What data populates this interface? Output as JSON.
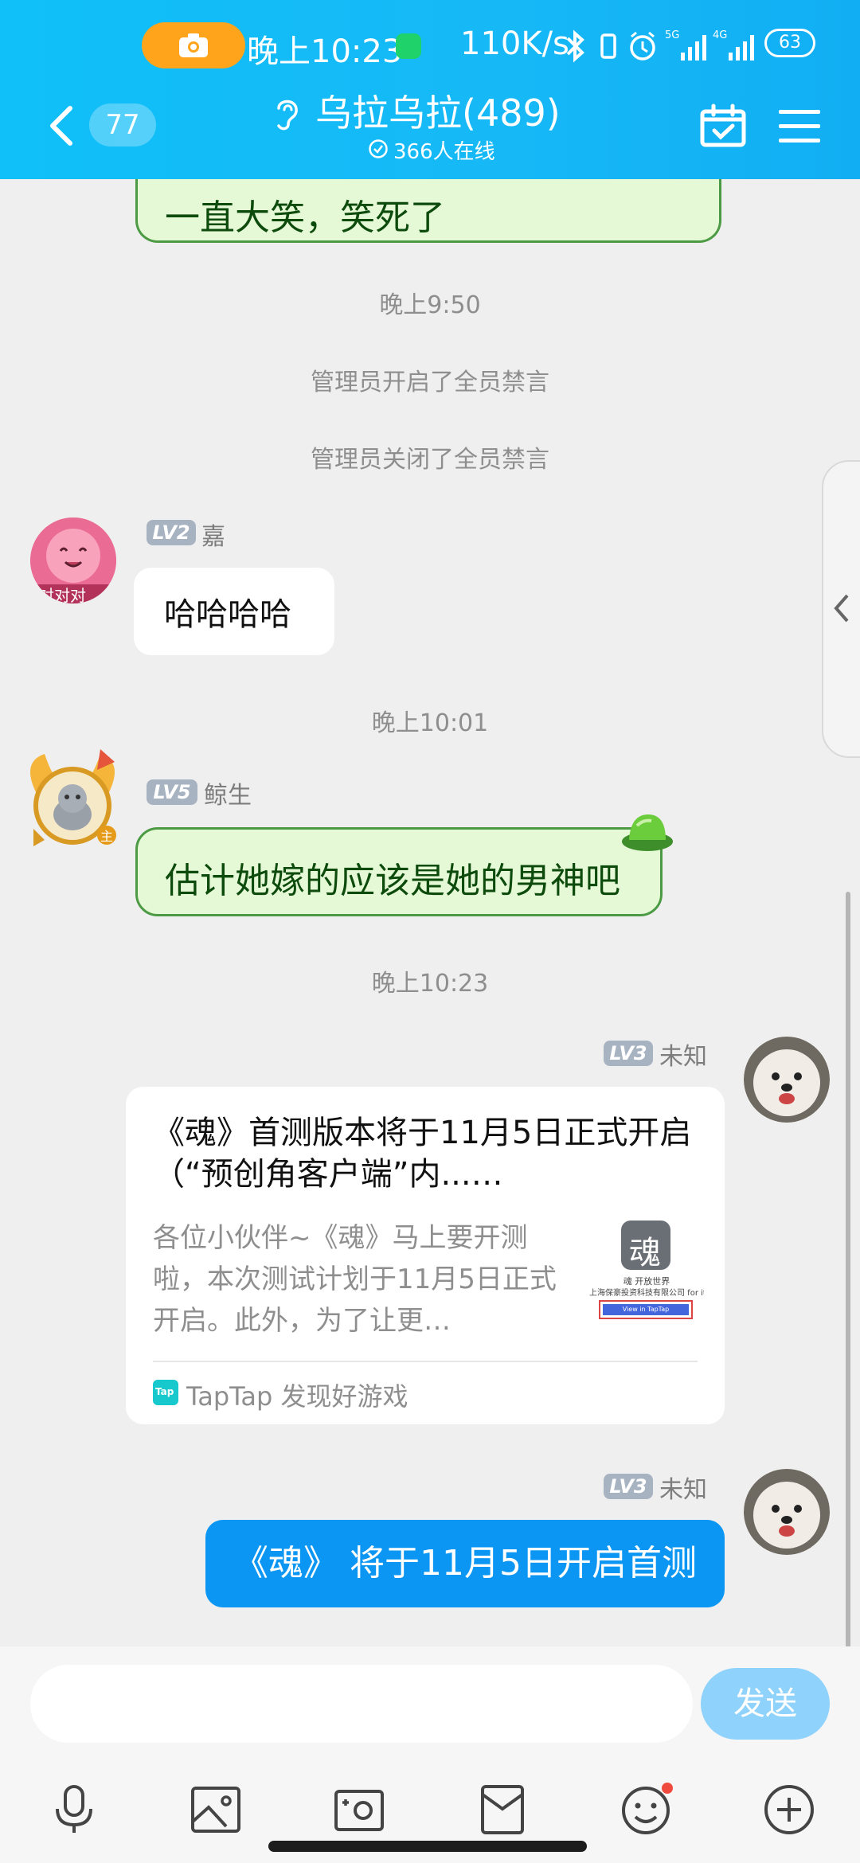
{
  "status_bar": {
    "time": "晚上10:23",
    "net_speed": "110K/s",
    "battery": "63"
  },
  "header": {
    "back_count": "77",
    "title": "乌拉乌拉(489)",
    "online": "366人在线"
  },
  "messages": {
    "m1": {
      "text": "一直大笑，笑死了"
    },
    "time1": "晚上9:50",
    "sys1": "管理员开启了全员禁言",
    "sys2": "管理员关闭了全员禁言",
    "m2": {
      "level": "LV2",
      "nick": "嘉",
      "avatar_text": "对对对",
      "text": "哈哈哈哈"
    },
    "time2": "晚上10:01",
    "m3": {
      "level": "LV5",
      "nick": "鲸生",
      "avatar_badge": "主",
      "text": "估计她嫁的应该是她的男神吧"
    },
    "time3": "晚上10:23",
    "m4": {
      "level": "LV3",
      "nick": "未知",
      "card_title": "《魂》首测版本将于11月5日正式开启（“预创角客户端”内...…",
      "card_desc": "各位小伙伴~《魂》马上要开测啦，本次测试计划于11月5日正式开启。此外，为了让更…",
      "thumb_logo": "魂",
      "thumb_line1": "魂 开放世界",
      "thumb_line2": "上海保豪投资科技有限公司 for it",
      "thumb_button": "View in TapTap",
      "source_icon": "Tap",
      "source": "TapTap 发现好游戏"
    },
    "m5": {
      "level": "LV3",
      "nick": "未知",
      "text": "《魂》 将于11月5日开启首测"
    }
  },
  "input": {
    "placeholder": "",
    "send_label": "发送"
  },
  "toolbar": [
    "microphone-icon",
    "image-icon",
    "camera-icon",
    "red-packet-icon",
    "emoji-icon",
    "plus-icon"
  ],
  "colors": {
    "header": "#16b8f6",
    "own_bubble": "#0a96f2",
    "send_button": "#8fd2fb",
    "green_bubble": "#e6f9d7"
  }
}
